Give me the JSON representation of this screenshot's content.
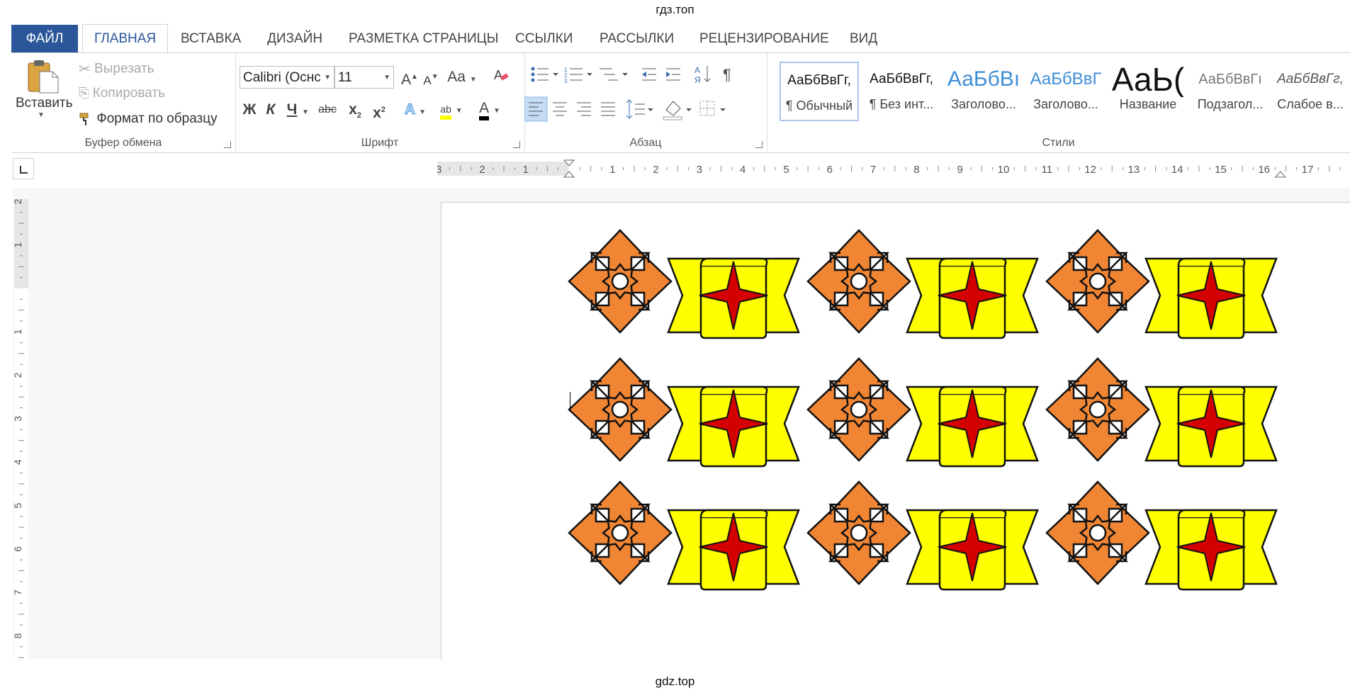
{
  "watermark_top": "гдз.топ",
  "watermark_bottom": "gdz.top",
  "tabs": [
    {
      "label": "ФАЙЛ"
    },
    {
      "label": "ГЛАВНАЯ"
    },
    {
      "label": "ВСТАВКА"
    },
    {
      "label": "ДИЗАЙН"
    },
    {
      "label": "РАЗМЕТКА СТРАНИЦЫ"
    },
    {
      "label": "ССЫЛКИ"
    },
    {
      "label": "РАССЫЛКИ"
    },
    {
      "label": "РЕЦЕНЗИРОВАНИЕ"
    },
    {
      "label": "ВИД"
    }
  ],
  "clipboard": {
    "paste_label": "Вставить",
    "cut_label": "Вырезать",
    "copy_label": "Копировать",
    "format_painter_label": "Формат по образцу",
    "group_label": "Буфер обмена"
  },
  "font": {
    "family_value": "Calibri (Оснс",
    "size_value": "11",
    "case_label": "Aa",
    "bold": "Ж",
    "italic": "К",
    "underline": "Ч",
    "strike": "abc",
    "sub": "x",
    "sup": "x",
    "sub_mark": "2",
    "sup_mark": "2",
    "grow": "A",
    "shrink": "A",
    "color_letter": "A",
    "effects_letter": "A",
    "highlight_letters": "ab",
    "group_label": "Шрифт"
  },
  "paragraph": {
    "group_label": "Абзац",
    "sort_label": "А↓",
    "pilcrow": "¶"
  },
  "styles": {
    "group_label": "Стили",
    "items": [
      {
        "preview": "АаБбВвГг,",
        "name": "¶ Обычный"
      },
      {
        "preview": "АаБбВвГг,",
        "name": "¶ Без инт..."
      },
      {
        "preview": "АаБбВı",
        "name": "Заголово..."
      },
      {
        "preview": "АаБбВвГ",
        "name": "Заголово..."
      },
      {
        "preview": "АаЬ(",
        "name": "Название"
      },
      {
        "preview": "АаБбВвГı",
        "name": "Подзагол..."
      },
      {
        "preview": "АаБбВвГг,",
        "name": "Слабое в..."
      }
    ]
  },
  "ruler": {
    "h_labels": [
      "3",
      "2",
      "1",
      "1",
      "2",
      "3",
      "4",
      "5",
      "6",
      "7",
      "8",
      "9",
      "10",
      "11",
      "12",
      "13",
      "14",
      "15",
      "16",
      "17"
    ],
    "v_labels": [
      "2",
      "1",
      "1",
      "2",
      "3",
      "4",
      "5",
      "6",
      "7",
      "8"
    ]
  },
  "document": {
    "pattern_rows": 3,
    "pattern_columns": 3,
    "colors": {
      "orange": "#f08534",
      "yellow": "#ffff00",
      "red": "#d40000",
      "outline": "#111111"
    }
  }
}
